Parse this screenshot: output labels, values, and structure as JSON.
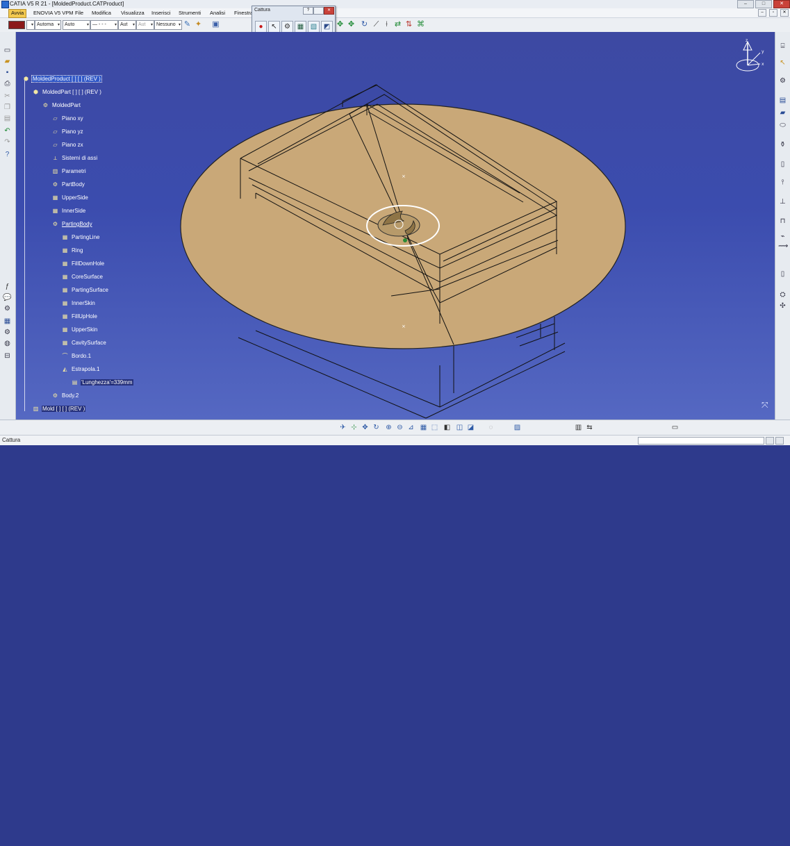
{
  "window": {
    "title": "CATIA V5 R 21 - [MoldedProduct.CATProduct]",
    "minimize": "–",
    "maximize": "□",
    "close": "✕"
  },
  "menu": {
    "items": [
      "Avvia",
      "ENOVIA V5 VPM",
      "File",
      "Modifica",
      "Visualizza",
      "Inserisci",
      "Strumenti",
      "Analisi",
      "Finestra"
    ],
    "active": "Avvia"
  },
  "mdi": {
    "minimize": "–",
    "restore": "▫",
    "close": "✕"
  },
  "toolbar": {
    "color_swatch": "#8b1a1a",
    "transparency": "Automa",
    "linetype": "Auto",
    "thickness": "— - - -",
    "layer_a": "Aut",
    "layer_b": "Aut",
    "layer_filter": "Nessuno"
  },
  "capture_dialog": {
    "title": "Cattura",
    "help": "?",
    "close": "✕",
    "icons": [
      "record-icon",
      "select-pointer-icon",
      "options-icon",
      "capture-3d-icon",
      "capture-image-icon",
      "album-icon"
    ]
  },
  "tree": [
    {
      "label": "MoldedProduct [ ] [ ] (REV )",
      "style": "sel"
    },
    {
      "label": "MoldedPart [ ] [ ] (REV )",
      "style": ""
    },
    {
      "label": "MoldedPart",
      "style": ""
    },
    {
      "label": "Piano xy",
      "style": ""
    },
    {
      "label": "Piano yz",
      "style": ""
    },
    {
      "label": "Piano zx",
      "style": ""
    },
    {
      "label": "Sistemi di assi",
      "style": ""
    },
    {
      "label": "Parametri",
      "style": ""
    },
    {
      "label": "PartBody",
      "style": ""
    },
    {
      "label": "UpperSide",
      "style": ""
    },
    {
      "label": "InnerSide",
      "style": ""
    },
    {
      "label": "PartingBody",
      "style": "ul"
    },
    {
      "label": "PartingLine",
      "style": ""
    },
    {
      "label": "Ring",
      "style": ""
    },
    {
      "label": "FillDownHole",
      "style": ""
    },
    {
      "label": "CoreSurface",
      "style": ""
    },
    {
      "label": "PartingSurface",
      "style": ""
    },
    {
      "label": "InnerSkin",
      "style": ""
    },
    {
      "label": "FillUpHole",
      "style": ""
    },
    {
      "label": "UpperSkin",
      "style": ""
    },
    {
      "label": "CavitySurface",
      "style": ""
    },
    {
      "label": "Bordo.1",
      "style": ""
    },
    {
      "label": "Estrapola.1",
      "style": ""
    },
    {
      "label": "'Lunghezza'=339mm",
      "style": "box"
    },
    {
      "label": "Body.2",
      "style": ""
    },
    {
      "label": "Mold [ ] [ ] (REV )",
      "style": "box"
    }
  ],
  "compass": {
    "x": "x",
    "y": "y",
    "z": "z"
  },
  "status": {
    "text": "Cattura"
  },
  "colors": {
    "viewport_top": "#3d49a2",
    "viewport_bottom": "#5568c2",
    "disc_fill": "#c9a878",
    "menu_active": "#f3c94f"
  },
  "logo": "CATIA"
}
